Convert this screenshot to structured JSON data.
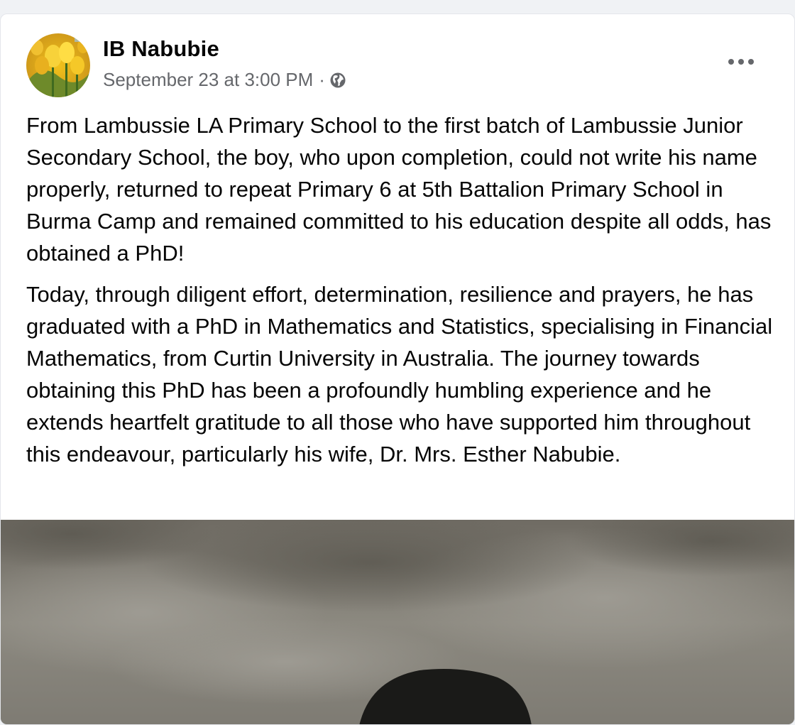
{
  "post": {
    "author": "IB Nabubie",
    "timestamp": "September 23 at 3:00 PM",
    "separator": "·",
    "privacy_icon": "globe-icon",
    "more_icon": "more-options-icon",
    "paragraphs": [
      "From Lambussie LA Primary School to the first batch of Lambussie Junior Secondary School, the boy, who upon completion, could not write his name properly, returned to repeat Primary 6 at 5th Battalion Primary School in Burma Camp and remained committed to his education despite all odds, has obtained a PhD!",
      "Today, through diligent effort, determination, resilience and prayers, he has graduated with a PhD in Mathematics and Statistics, specialising in Financial Mathematics, from Curtin University in Australia. The journey towards obtaining this PhD has been a profoundly humbling experience and he extends heartfelt gratitude to all those who have supported him throughout this endeavour, particularly his wife, Dr. Mrs. Esther Nabubie."
    ]
  },
  "colors": {
    "page_background": "#f0f2f5",
    "card_background": "#ffffff",
    "primary_text": "#050505",
    "secondary_text": "#65676b"
  }
}
